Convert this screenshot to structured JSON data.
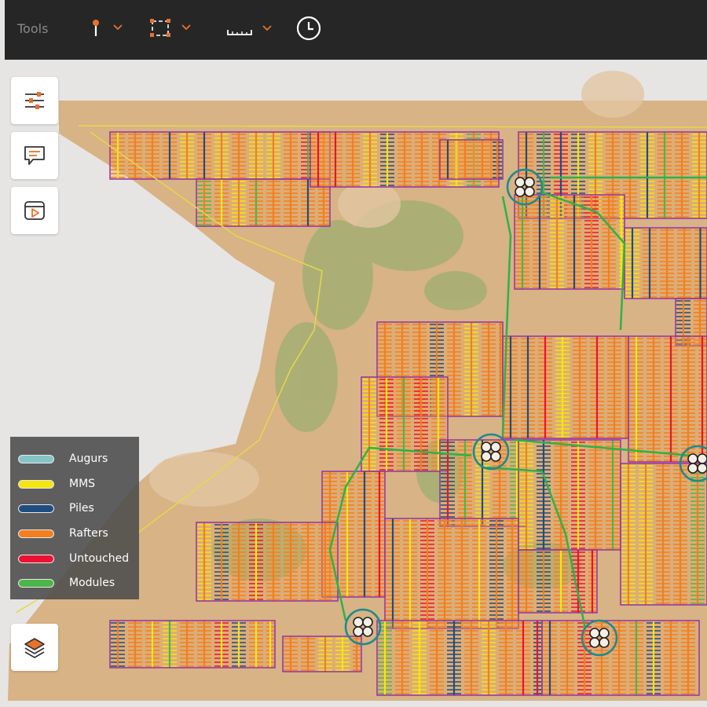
{
  "toolbar": {
    "label": "Tools",
    "tools": [
      {
        "name": "pin-tool",
        "icon": "map-pin-icon"
      },
      {
        "name": "select-area-tool",
        "icon": "select-area-icon"
      },
      {
        "name": "measure-tool",
        "icon": "ruler-icon"
      },
      {
        "name": "history-tool",
        "icon": "clock-icon"
      }
    ],
    "accent_color": "#e8722c"
  },
  "side_buttons": [
    {
      "name": "filters-button",
      "icon": "sliders-icon"
    },
    {
      "name": "comments-button",
      "icon": "comment-icon"
    },
    {
      "name": "media-button",
      "icon": "play-box-icon"
    },
    {
      "name": "layers-button",
      "icon": "layers-icon"
    }
  ],
  "legend": {
    "items": [
      {
        "label": "Augurs",
        "color": "#85c5c9"
      },
      {
        "label": "MMS",
        "color": "#f5e60f"
      },
      {
        "label": "Piles",
        "color": "#1f4d82"
      },
      {
        "label": "Rafters",
        "color": "#f37f1e"
      },
      {
        "label": "Untouched",
        "color": "#ee1133"
      },
      {
        "label": "Modules",
        "color": "#4cb648"
      }
    ]
  },
  "map": {
    "layer_colors": {
      "boundary": "#8e2aa8",
      "road": "#2cb24a",
      "trail": "#e6d84a",
      "substation": "#1e8a8e"
    }
  }
}
